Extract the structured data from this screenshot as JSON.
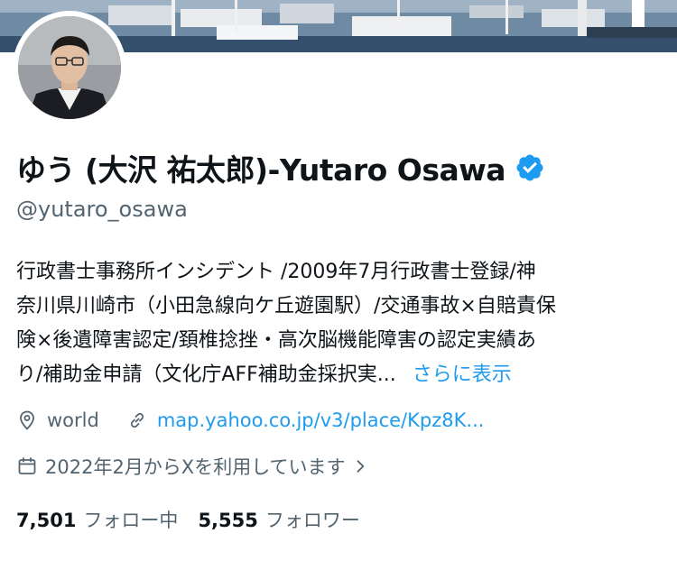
{
  "profile": {
    "display_name": "ゆう (大沢 祐太郎)-Yutaro Osawa",
    "handle": "@yutaro_osawa",
    "verified": true,
    "verified_icon": "verified-badge-icon",
    "bio_lines": [
      "行政書士事務所インシデント /2009年7月行政書士登録/神",
      "奈川県川崎市（小田急線向ケ丘遊園駅）/交通事故×自賠責保",
      "険×後遺障害認定/頚椎捻挫・高次脳機能障害の認定実績あ",
      "り/補助金申請（文化庁AFF補助金採択実..."
    ],
    "bio_more_label": "さらに表示",
    "location": "world",
    "website": "map.yahoo.co.jp/v3/place/Kpz8K...",
    "joined": "2022年2月からXを利用しています",
    "following_count": "7,501",
    "following_label": "フォロー中",
    "followers_count": "5,555",
    "followers_label": "フォロワー"
  },
  "icons": {
    "location": "location-pin-icon",
    "website": "link-icon",
    "joined": "calendar-icon",
    "joined_more": "chevron-right-icon"
  },
  "colors": {
    "accent": "#1d9bf0",
    "text": "#0f1419",
    "secondary": "#536471",
    "background": "#ffffff"
  }
}
